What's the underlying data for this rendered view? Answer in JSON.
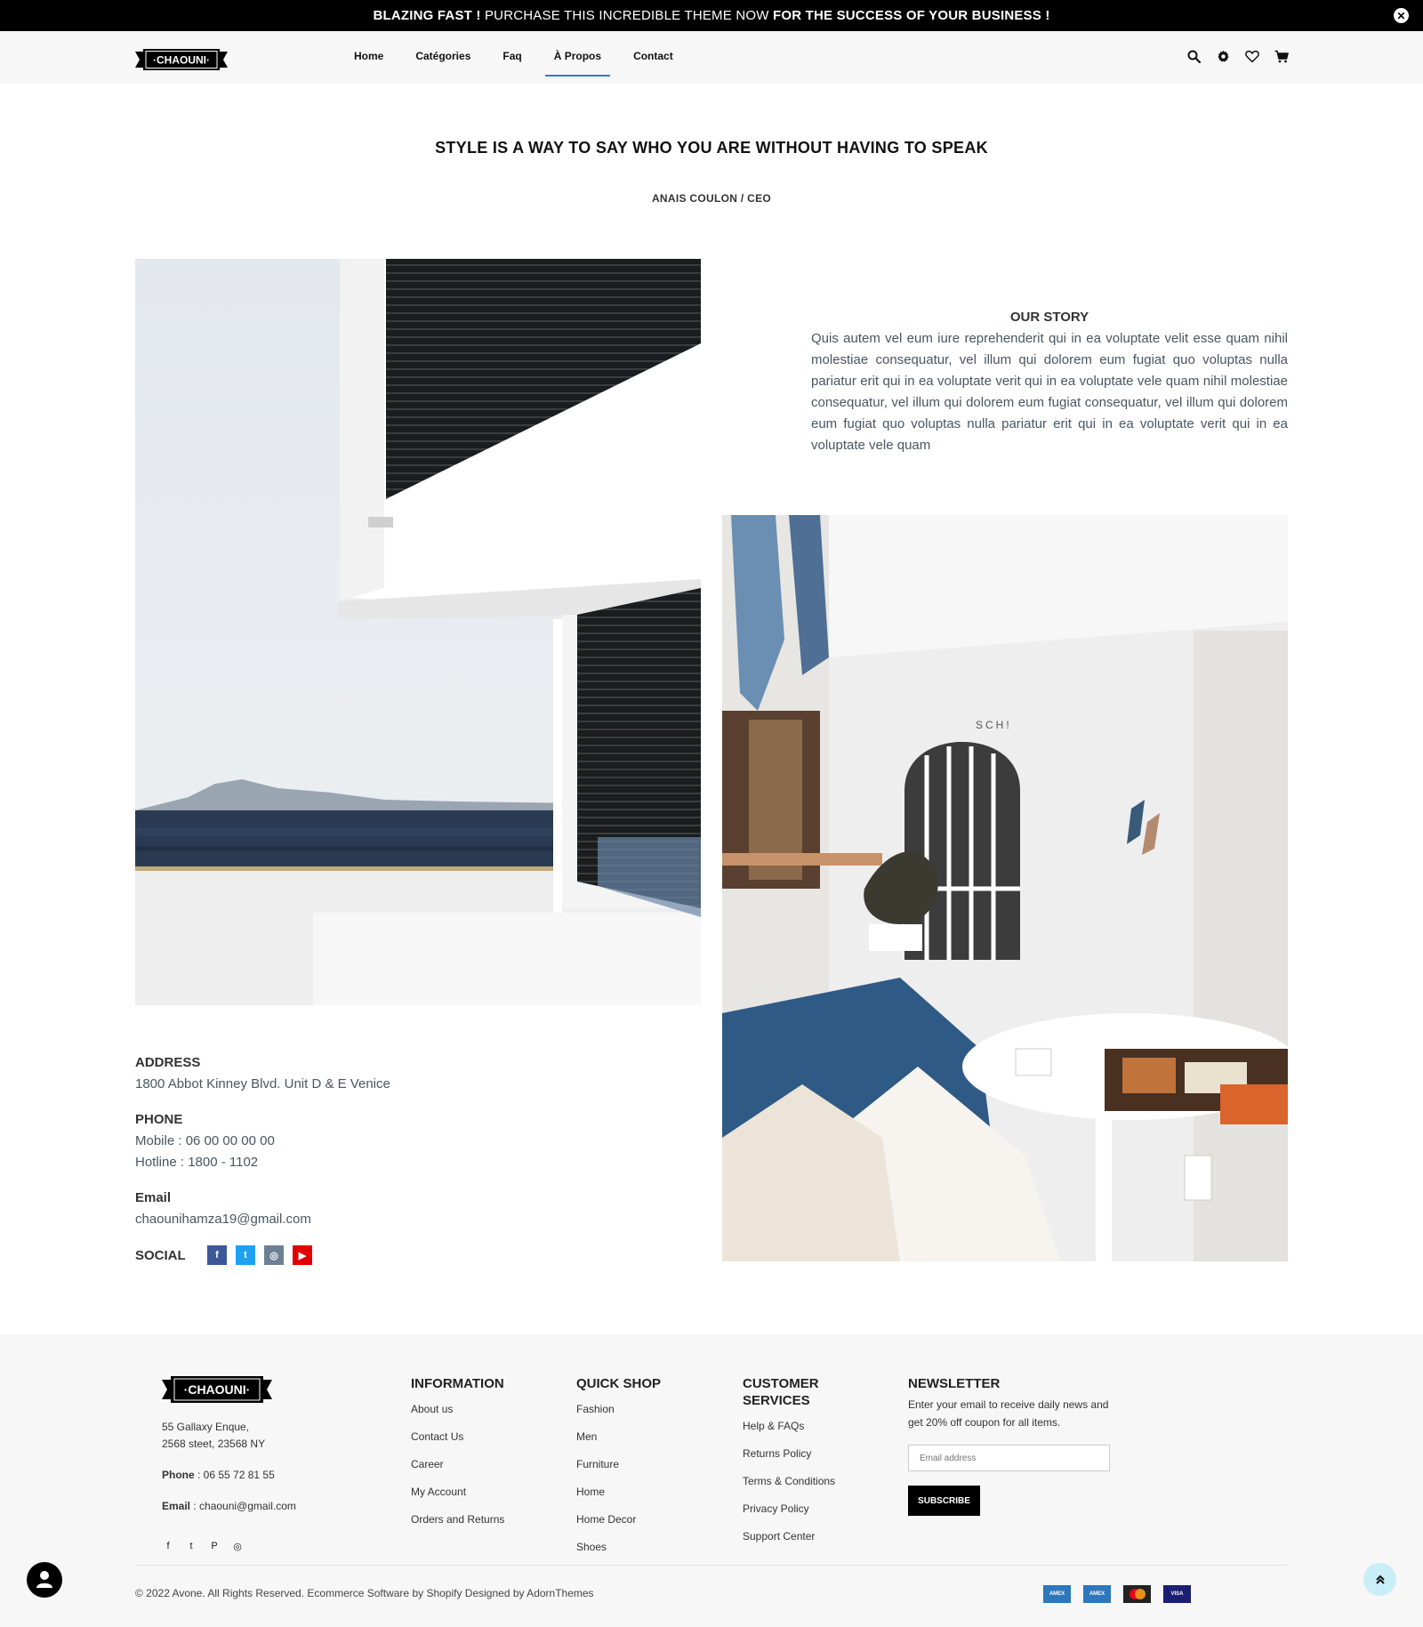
{
  "announcement": {
    "part1": "BLAZING FAST !",
    "part2": " PURCHASE THIS INCREDIBLE THEME NOW ",
    "part3": "FOR THE SUCCESS OF YOUR BUSINESS !",
    "close_glyph": "✕"
  },
  "header": {
    "logo_text": "·CHAOUNI·",
    "nav": [
      "Home",
      "Catégories",
      "Faq",
      "À Propos",
      "Contact"
    ],
    "active_nav": "À Propos",
    "icons": [
      "search-icon",
      "gear-icon",
      "heart-icon",
      "cart-icon"
    ]
  },
  "quote": {
    "text": "STYLE IS A WAY TO SAY WHO YOU ARE WITHOUT HAVING TO SPEAK",
    "author": "ANAIS COULON / CEO"
  },
  "story": {
    "title": "OUR STORY",
    "text": "Quis autem vel eum iure reprehenderit qui in ea voluptate velit esse quam nihil molestiae consequatur, vel illum qui dolorem eum fugiat quo voluptas nulla pariatur erit qui in ea voluptate verit qui in ea voluptate vele quam nihil molestiae consequatur, vel illum qui dolorem eum fugiat consequatur, vel illum qui dolorem eum fugiat quo voluptas nulla pariatur erit qui in ea voluptate verit qui in ea voluptate vele quam"
  },
  "contact": {
    "address_label": "ADDRESS",
    "address": "1800 Abbot Kinney Blvd. Unit D & E Venice",
    "phone_label": "PHONE",
    "mobile": "Mobile : 06 00 00 00 00",
    "hotline": "Hotline : 1800 - 1102",
    "email_label": "Email",
    "email": "chaounihamza19@gmail.com",
    "social_label": "SOCIAL",
    "social": [
      {
        "name": "facebook",
        "glyph": "f",
        "color": "#3b5998"
      },
      {
        "name": "twitter",
        "glyph": "t",
        "color": "#1da1f2"
      },
      {
        "name": "instagram",
        "glyph": "◎",
        "color": "#6d7f94"
      },
      {
        "name": "youtube",
        "glyph": "▶",
        "color": "#e00000"
      }
    ]
  },
  "footer": {
    "logo_text": "·CHAOUNI·",
    "address_line1": "55 Gallaxy Enque,",
    "address_line2": "2568 steet, 23568 NY",
    "phone_label": "Phone",
    "phone": " : 06 55 72 81 55",
    "email_label": "Email",
    "email": " : chaouni@gmail.com",
    "social_glyphs": [
      "f",
      "t",
      "P",
      "◎"
    ],
    "columns": [
      {
        "title": "INFORMATION",
        "links": [
          "About us",
          "Contact Us",
          "Career",
          "My Account",
          "Orders and Returns"
        ]
      },
      {
        "title": "QUICK SHOP",
        "links": [
          "Fashion",
          "Men",
          "Furniture",
          "Home",
          "Home Decor",
          "Shoes"
        ]
      },
      {
        "title": "CUSTOMER SERVICES",
        "links": [
          "Help & FAQs",
          "Returns Policy",
          "Terms & Conditions",
          "Privacy Policy",
          "Support Center"
        ]
      }
    ],
    "newsletter": {
      "title": "NEWSLETTER",
      "text": "Enter your email to receive daily news and get 20% off coupon for all items.",
      "placeholder": "Email address",
      "button": "SUBSCRIBE"
    },
    "copyright": "© 2022 Avone. All Rights Reserved. Ecommerce Software by Shopify Designed by AdornThemes",
    "payments": [
      {
        "label": "AMEX",
        "color": "#2e77bc"
      },
      {
        "label": "AMEX",
        "color": "#2e77bc"
      },
      {
        "label": "MC",
        "color": "#222222"
      },
      {
        "label": "VISA",
        "color": "#1a1f71"
      }
    ]
  }
}
